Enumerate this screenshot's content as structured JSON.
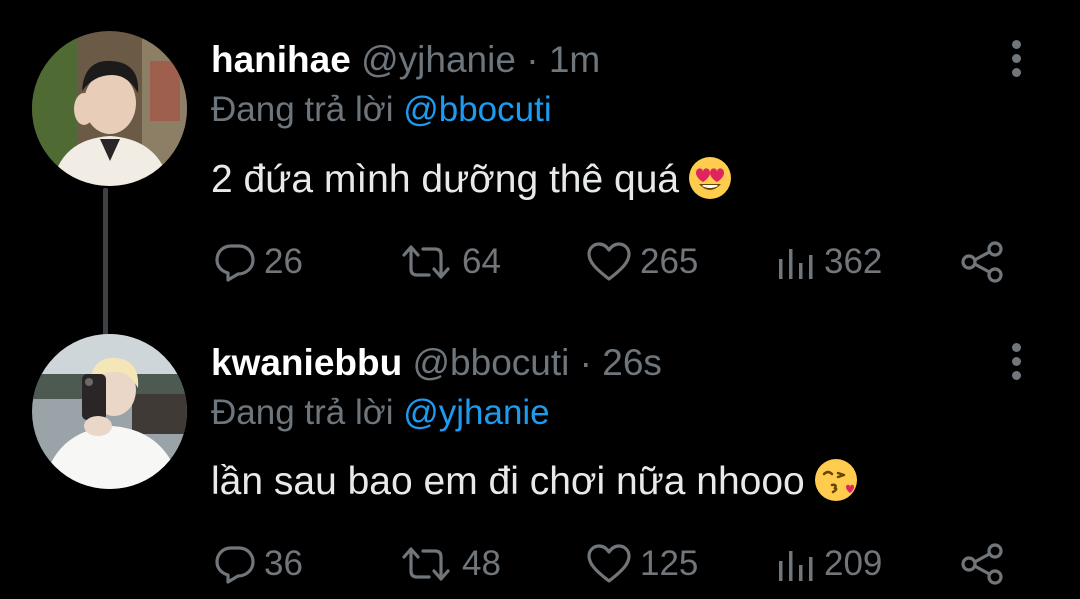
{
  "tweets": [
    {
      "display_name": "hanihae",
      "handle": "@yjhanie",
      "separator": "·",
      "time": "1m",
      "reply_prefix": "Đang trả lời",
      "reply_to": "@bbocuti",
      "text": "2 đứa mình dưỡng thê quá",
      "emoji": "heart-eyes-emoji",
      "replies": "26",
      "retweets": "64",
      "likes": "265",
      "views": "362"
    },
    {
      "display_name": "kwaniebbu",
      "handle": "@bbocuti",
      "separator": "·",
      "time": "26s",
      "reply_prefix": "Đang trả lời",
      "reply_to": "@yjhanie",
      "text": "lần sau bao em đi chơi nữa nhooo",
      "emoji": "kissing-heart-emoji",
      "replies": "36",
      "retweets": "48",
      "likes": "125",
      "views": "209"
    }
  ],
  "colors": {
    "background": "#000000",
    "text": "#e7e9ea",
    "muted": "#6e767d",
    "link": "#1d9bf0"
  },
  "icons": [
    "reply-icon",
    "retweet-icon",
    "like-icon",
    "views-icon",
    "share-icon",
    "more-options-icon"
  ]
}
